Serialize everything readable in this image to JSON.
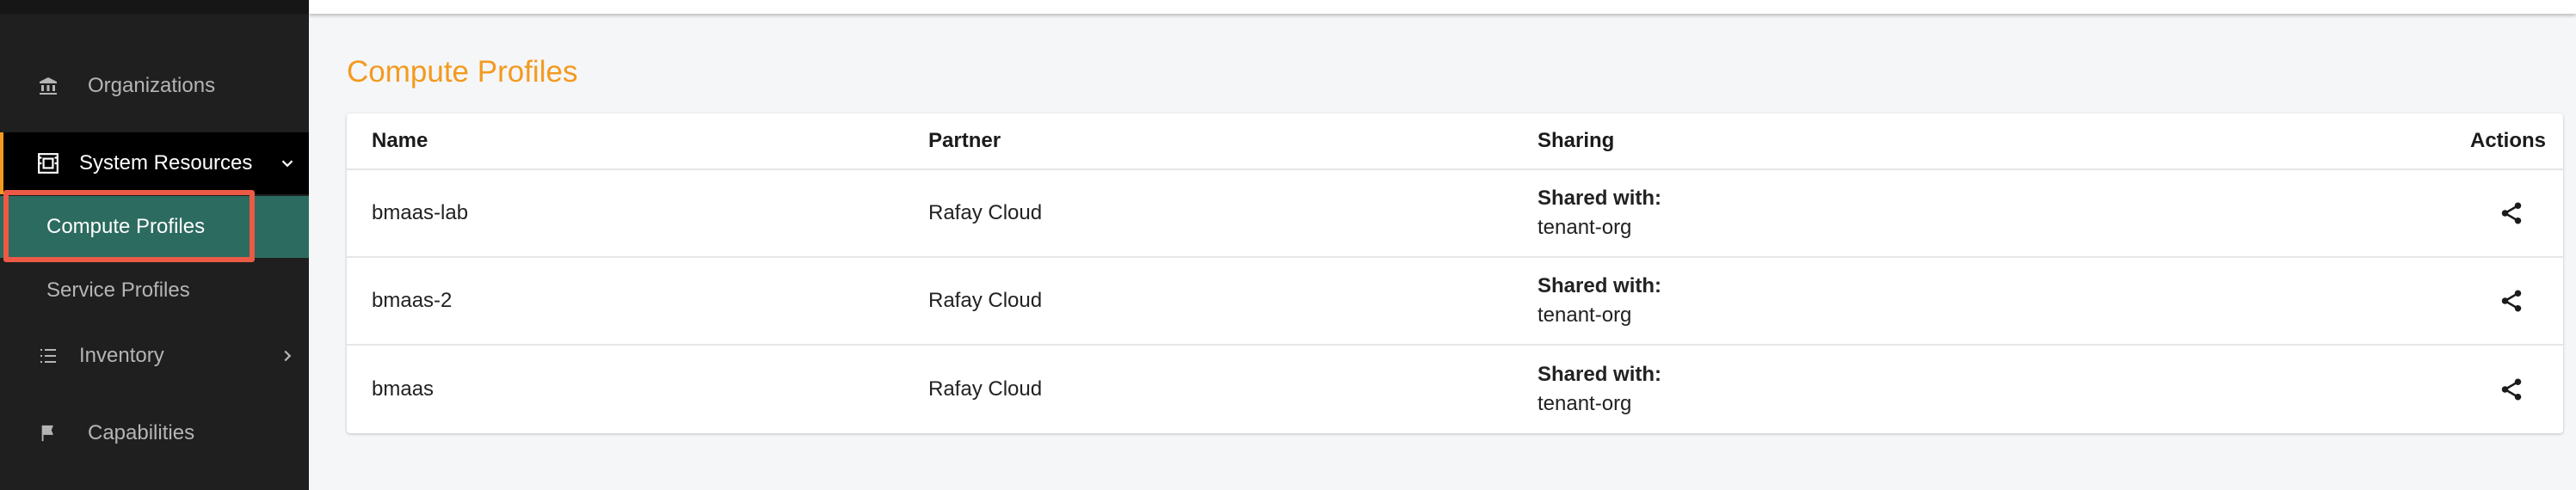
{
  "sidebar": {
    "organizations": {
      "label": "Organizations",
      "icon": "bank-icon"
    },
    "system_resources": {
      "label": "System Resources",
      "icon": "resources-icon",
      "expanded": true
    },
    "compute_profiles": {
      "label": "Compute Profiles",
      "active": true
    },
    "service_profiles": {
      "label": "Service Profiles"
    },
    "inventory": {
      "label": "Inventory",
      "icon": "list-icon"
    },
    "capabilities": {
      "label": "Capabilities",
      "icon": "flag-icon"
    }
  },
  "main": {
    "title": "Compute Profiles",
    "table": {
      "columns": [
        "Name",
        "Partner",
        "Sharing",
        "Actions"
      ],
      "rows": [
        {
          "name": "bmaas-lab",
          "partner": "Rafay Cloud",
          "sharing_label": "Shared with:",
          "sharing_value": "tenant-org"
        },
        {
          "name": "bmaas-2",
          "partner": "Rafay Cloud",
          "sharing_label": "Shared with:",
          "sharing_value": "tenant-org"
        },
        {
          "name": "bmaas",
          "partner": "Rafay Cloud",
          "sharing_label": "Shared with:",
          "sharing_value": "tenant-org"
        }
      ]
    }
  },
  "colors": {
    "accent": "#f39a1f",
    "active_item": "#2c6b60",
    "highlight": "#ec5a46",
    "sidebar_bg": "#1f1f1f"
  }
}
